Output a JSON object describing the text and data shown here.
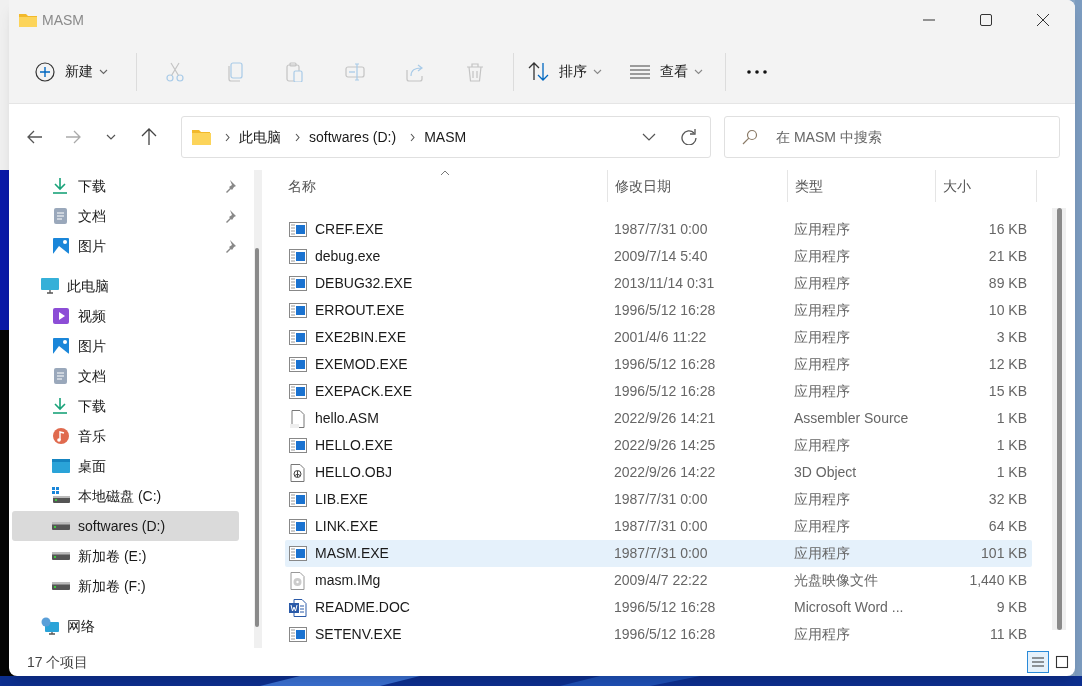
{
  "window": {
    "title": "MASM"
  },
  "toolbar": {
    "new_button": {
      "label": "新建"
    },
    "actions": [
      {
        "kind": "cut",
        "disabled": true
      },
      {
        "kind": "copy",
        "disabled": true
      },
      {
        "kind": "paste",
        "disabled": true
      },
      {
        "kind": "rename",
        "disabled": true
      },
      {
        "kind": "share",
        "disabled": true
      },
      {
        "kind": "delete",
        "disabled": true
      }
    ],
    "sort_button": {
      "label": "排序"
    },
    "view_button": {
      "label": "查看"
    }
  },
  "address_bar": {
    "breadcrumbs": [
      "此电脑",
      "softwares (D:)",
      "MASM"
    ]
  },
  "search": {
    "placeholder": "在 MASM 中搜索"
  },
  "sidebar": {
    "quick_access": [
      {
        "label": "下载",
        "kind": "download",
        "pinned": true
      },
      {
        "label": "文档",
        "kind": "document",
        "pinned": true
      },
      {
        "label": "图片",
        "kind": "pictures",
        "pinned": true
      }
    ],
    "tree": [
      {
        "label": "此电脑",
        "kind": "pc",
        "selected": false,
        "children": [
          {
            "label": "视频",
            "kind": "video",
            "selected": false
          },
          {
            "label": "图片",
            "kind": "pictures",
            "selected": false
          },
          {
            "label": "文档",
            "kind": "document",
            "selected": false
          },
          {
            "label": "下载",
            "kind": "download",
            "selected": false
          },
          {
            "label": "音乐",
            "kind": "music",
            "selected": false
          },
          {
            "label": "桌面",
            "kind": "desktop",
            "selected": false
          },
          {
            "label": "本地磁盘 (C:)",
            "kind": "system-drive",
            "selected": false
          },
          {
            "label": "softwares (D:)",
            "kind": "drive",
            "selected": true
          },
          {
            "label": "新加卷 (E:)",
            "kind": "drive",
            "selected": false
          },
          {
            "label": "新加卷 (F:)",
            "kind": "drive",
            "selected": false
          }
        ]
      },
      {
        "label": "网络",
        "kind": "network",
        "selected": false
      }
    ]
  },
  "table": {
    "columns": [
      "名称",
      "修改日期",
      "类型",
      "大小"
    ],
    "rows": [
      {
        "name": "CREF.EXE",
        "date": "1987/7/31 0:00",
        "type": "应用程序",
        "size": "16 KB",
        "kind": "exe",
        "selected": false
      },
      {
        "name": "debug.exe",
        "date": "2009/7/14 5:40",
        "type": "应用程序",
        "size": "21 KB",
        "kind": "exe",
        "selected": false
      },
      {
        "name": "DEBUG32.EXE",
        "date": "2013/11/14 0:31",
        "type": "应用程序",
        "size": "89 KB",
        "kind": "exe",
        "selected": false
      },
      {
        "name": "ERROUT.EXE",
        "date": "1996/5/12 16:28",
        "type": "应用程序",
        "size": "10 KB",
        "kind": "exe",
        "selected": false
      },
      {
        "name": "EXE2BIN.EXE",
        "date": "2001/4/6 11:22",
        "type": "应用程序",
        "size": "3 KB",
        "kind": "exe",
        "selected": false
      },
      {
        "name": "EXEMOD.EXE",
        "date": "1996/5/12 16:28",
        "type": "应用程序",
        "size": "12 KB",
        "kind": "exe",
        "selected": false
      },
      {
        "name": "EXEPACK.EXE",
        "date": "1996/5/12 16:28",
        "type": "应用程序",
        "size": "15 KB",
        "kind": "exe",
        "selected": false
      },
      {
        "name": "hello.ASM",
        "date": "2022/9/26 14:21",
        "type": "Assembler Source",
        "size": "1 KB",
        "kind": "asm",
        "selected": false
      },
      {
        "name": "HELLO.EXE",
        "date": "2022/9/26 14:25",
        "type": "应用程序",
        "size": "1 KB",
        "kind": "exe",
        "selected": false
      },
      {
        "name": "HELLO.OBJ",
        "date": "2022/9/26 14:22",
        "type": "3D Object",
        "size": "1 KB",
        "kind": "obj",
        "selected": false
      },
      {
        "name": "LIB.EXE",
        "date": "1987/7/31 0:00",
        "type": "应用程序",
        "size": "32 KB",
        "kind": "exe",
        "selected": false
      },
      {
        "name": "LINK.EXE",
        "date": "1987/7/31 0:00",
        "type": "应用程序",
        "size": "64 KB",
        "kind": "exe",
        "selected": false
      },
      {
        "name": "MASM.EXE",
        "date": "1987/7/31 0:00",
        "type": "应用程序",
        "size": "101 KB",
        "kind": "exe",
        "selected": true
      },
      {
        "name": "masm.IMg",
        "date": "2009/4/7 22:22",
        "type": "光盘映像文件",
        "size": "1,440 KB",
        "kind": "img",
        "selected": false
      },
      {
        "name": "README.DOC",
        "date": "1996/5/12 16:28",
        "type": "Microsoft Word ...",
        "size": "9 KB",
        "kind": "doc",
        "selected": false
      },
      {
        "name": "SETENV.EXE",
        "date": "1996/5/12 16:28",
        "type": "应用程序",
        "size": "11 KB",
        "kind": "exe",
        "selected": false
      }
    ]
  },
  "status_bar": {
    "item_count": "17 个项目",
    "views": [
      {
        "kind": "details",
        "selected": true
      },
      {
        "kind": "tiles",
        "selected": false
      }
    ]
  }
}
